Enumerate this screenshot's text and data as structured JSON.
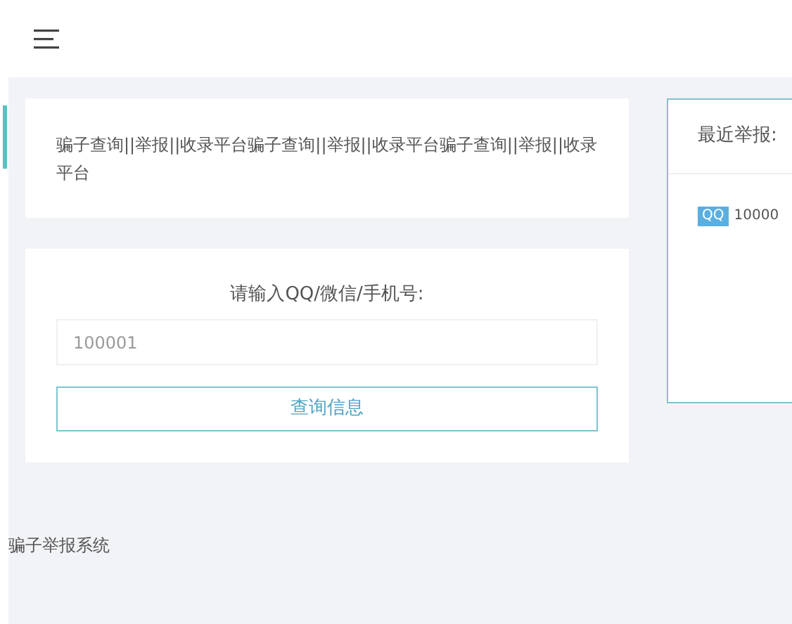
{
  "intro": {
    "text": "骗子查询||举报||收录平台骗子查询||举报||收录平台骗子查询||举报||收录平台"
  },
  "search": {
    "label": "请输入QQ/微信/手机号:",
    "placeholder": "100001",
    "button": "查询信息"
  },
  "recent": {
    "title": "最近举报:",
    "items": [
      {
        "tag": "QQ",
        "value": "10000"
      }
    ]
  },
  "footer": {
    "text": "骗子举报系统"
  }
}
